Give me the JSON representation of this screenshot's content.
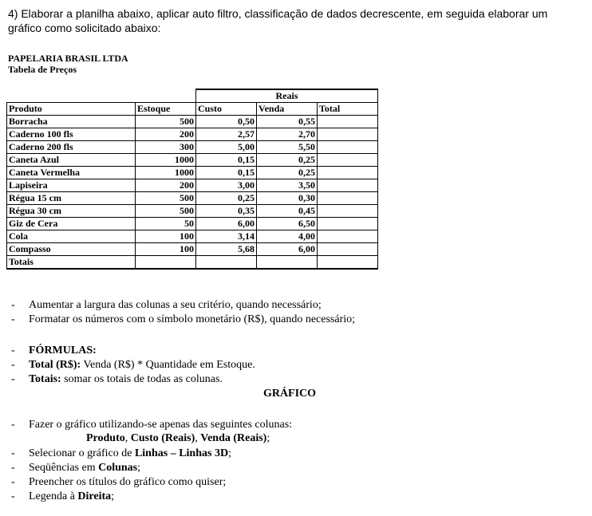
{
  "intro": "4) Elaborar a planilha abaixo, aplicar auto filtro, classificação de dados decrescente, em seguida elaborar um gráfico como solicitado abaixo:",
  "company": "PAPELARIA BRASIL LTDA",
  "subtitle": "Tabela de Preços",
  "table": {
    "group_header": "Reais",
    "headers": [
      "Produto",
      "Estoque",
      "Custo",
      "Venda",
      "Total"
    ],
    "rows": [
      [
        "Borracha",
        "500",
        "0,50",
        "0,55",
        ""
      ],
      [
        "Caderno 100 fls",
        "200",
        "2,57",
        "2,70",
        ""
      ],
      [
        "Caderno 200 fls",
        "300",
        "5,00",
        "5,50",
        ""
      ],
      [
        "Caneta Azul",
        "1000",
        "0,15",
        "0,25",
        ""
      ],
      [
        "Caneta Vermelha",
        "1000",
        "0,15",
        "0,25",
        ""
      ],
      [
        "Lapiseira",
        "200",
        "3,00",
        "3,50",
        ""
      ],
      [
        "Régua 15 cm",
        "500",
        "0,25",
        "0,30",
        ""
      ],
      [
        "Régua 30 cm",
        "500",
        "0,35",
        "0,45",
        ""
      ],
      [
        "Giz de Cera",
        "50",
        "6,00",
        "6,50",
        ""
      ],
      [
        "Cola",
        "100",
        "3,14",
        "4,00",
        ""
      ],
      [
        "Compasso",
        "100",
        "5,68",
        "6,00",
        ""
      ]
    ],
    "totals_label": "Totais"
  },
  "notes1": [
    "Aumentar a largura das colunas a seu critério, quando necessário;",
    "Formatar os números com o símbolo monetário (R$), quando necessário;"
  ],
  "formulas": {
    "heading": "FÓRMULAS:",
    "total_label": "Total (R$):",
    "total_text": " Venda (R$) * Quantidade em Estoque.",
    "totais_label": "Totais:",
    "totais_text": " somar os totais de todas as colunas."
  },
  "grafico": {
    "heading": "GRÁFICO",
    "item1": "Fazer o gráfico utilizando-se apenas das seguintes colunas:",
    "cols_a": "Produto",
    "cols_sep1": ", ",
    "cols_b": "Custo (Reais)",
    "cols_sep2": ", ",
    "cols_c": "Venda (Reais)",
    "cols_end": ";",
    "item2_pre": "Selecionar o gráfico de ",
    "item2_bold": "Linhas – Linhas 3D",
    "item2_end": ";",
    "item3_pre": "Seqüências em ",
    "item3_bold": "Colunas",
    "item3_end": ";",
    "item4": "Preencher os títulos do gráfico como quiser;",
    "item5_pre": "Legenda à ",
    "item5_bold": "Direita",
    "item5_end": ";"
  }
}
